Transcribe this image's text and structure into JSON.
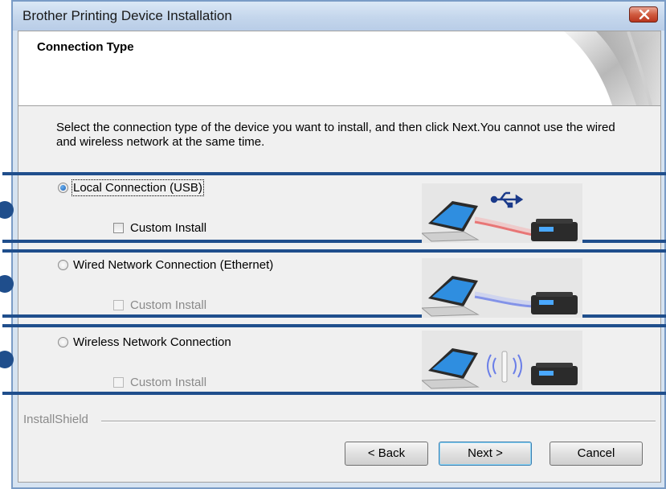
{
  "window": {
    "title": "Brother Printing Device Installation"
  },
  "header": {
    "title": "Connection Type"
  },
  "intro_text": "Select the connection type of the device you want to install, and then click Next.You cannot use the wired and wireless network at the same time.",
  "options": [
    {
      "label": "Local Connection (USB)",
      "selected": true,
      "custom_install_label": "Custom Install",
      "custom_install_enabled": true,
      "custom_install_checked": false
    },
    {
      "label": "Wired Network Connection (Ethernet)",
      "selected": false,
      "custom_install_label": "Custom Install",
      "custom_install_enabled": false,
      "custom_install_checked": false
    },
    {
      "label": "Wireless Network Connection",
      "selected": false,
      "custom_install_label": "Custom Install",
      "custom_install_enabled": false,
      "custom_install_checked": false
    }
  ],
  "footer": {
    "brand": "InstallShield"
  },
  "buttons": {
    "back": "< Back",
    "next": "Next >",
    "cancel": "Cancel"
  },
  "colors": {
    "annotation_blue": "#1f4e8c",
    "usb_cable": "#e85a5a",
    "ethernet_cable": "#6a7ee8"
  }
}
